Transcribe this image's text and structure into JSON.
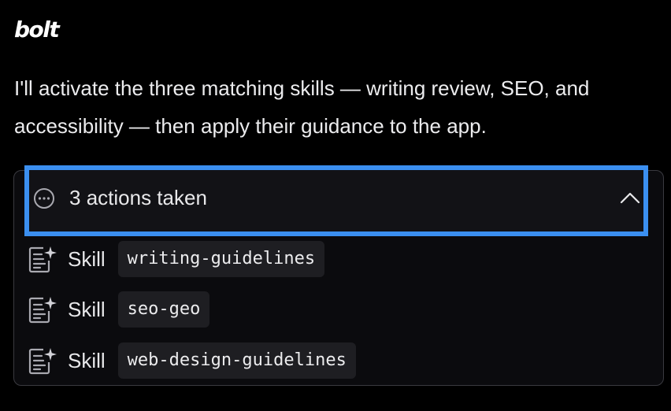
{
  "app": {
    "logo_text": "bolt"
  },
  "message": {
    "text": "I'll activate the three matching skills — writing review, SEO, and accessibility — then apply their guidance to the app."
  },
  "actions": {
    "count": "3",
    "summary": "actions taken",
    "expanded": true,
    "header_icon": "more-horizontal-circle-icon",
    "toggle_icon": "chevron-up-icon",
    "highlight_color": "#3b8ff0",
    "items": [
      {
        "type": "Skill",
        "name": "writing-guidelines",
        "icon": "skill-document-sparkle-icon"
      },
      {
        "type": "Skill",
        "name": "seo-geo",
        "icon": "skill-document-sparkle-icon"
      },
      {
        "type": "Skill",
        "name": "web-design-guidelines",
        "icon": "skill-document-sparkle-icon"
      }
    ]
  }
}
